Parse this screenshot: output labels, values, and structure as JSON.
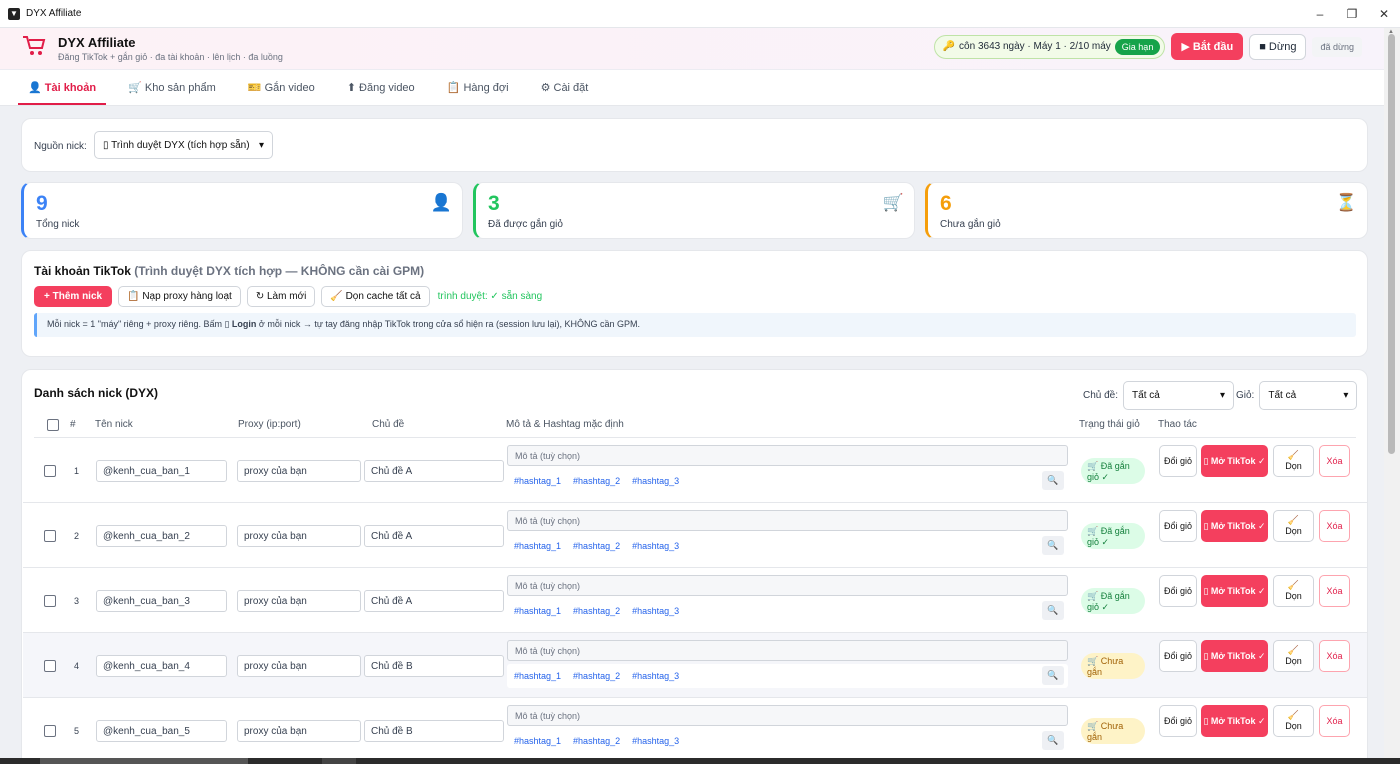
{
  "window": {
    "title": "DYX Affiliate",
    "minimize": "–",
    "maximize": "❐",
    "close": "✕"
  },
  "header": {
    "title": "DYX Affiliate",
    "subtitle": "Đăng TikTok + gắn giỏ · đa tài khoản · lên lịch · đa luồng",
    "license": "côn 3643 ngày · Máy 1 · 2/10 máy",
    "renew": "Gia hạn",
    "start": "▶ Bắt đầu",
    "stop": "■ Dừng",
    "status": "đã dừng"
  },
  "tabs": [
    "Tài khoản",
    "Kho sản phẩm",
    "Gắn video",
    "Đăng video",
    "Hàng đợi",
    "Cài đặt"
  ],
  "source": {
    "label": "Nguồn nick:",
    "value": "▯ Trình duyệt DYX (tích hợp sẵn)"
  },
  "stats": [
    {
      "value": "9",
      "label": "Tổng nick",
      "color": "#3b82f6"
    },
    {
      "value": "3",
      "label": "Đã được gắn giỏ",
      "color": "#22c55e"
    },
    {
      "value": "6",
      "label": "Chưa gắn giỏ",
      "color": "#f59e0b"
    }
  ],
  "accounts": {
    "title": "Tài khoản TikTok",
    "title_note": "(Trình duyệt DYX tích hợp — KHÔNG cần cài GPM)",
    "add": "+ Thêm nick",
    "proxy_bulk": "Nạp proxy hàng loạt",
    "refresh": "↻ Làm mới",
    "clear_cache": "Dọn cache tất cả",
    "browser_status": "trình duyệt: ✓ sẵn sàng",
    "note_pre": "Mỗi nick = 1 \"máy\" riêng + proxy riêng. Bấm ",
    "note_bold": "▯ Login",
    "note_post": " ở mỗi nick → tự tay đăng nhập TikTok trong cửa sổ hiện ra (session lưu lại), KHÔNG cần GPM."
  },
  "list": {
    "title": "Danh sách nick (DYX)",
    "topic_label": "Chủ đề:",
    "topic_value": "Tất cả",
    "cart_label": "Giỏ:",
    "cart_value": "Tất cả",
    "columns": [
      "#",
      "Tên nick",
      "Proxy (ip:port)",
      "Chủ đề",
      "Mô tả & Hashtag mặc định",
      "Trạng thái giỏ",
      "Thao tác"
    ],
    "desc_placeholder": "Mô tả (tuỳ chọn)",
    "hashtags": [
      "#hashtag_1",
      "#hashtag_2",
      "#hashtag_3"
    ],
    "btn_change": "Đổi giỏ",
    "btn_open": "▯ Mở TikTok ✓",
    "btn_clean": "Dọn",
    "btn_delete": "Xóa",
    "rows": [
      {
        "idx": "1",
        "nick": "@kenh_cua_ban_1",
        "proxy": "proxy của bạn",
        "topic": "Chủ đề A",
        "status": "Đã gắn giỏ ✓",
        "state": "ok"
      },
      {
        "idx": "2",
        "nick": "@kenh_cua_ban_2",
        "proxy": "proxy của bạn",
        "topic": "Chủ đề A",
        "status": "Đã gắn giỏ ✓",
        "state": "ok"
      },
      {
        "idx": "3",
        "nick": "@kenh_cua_ban_3",
        "proxy": "proxy của bạn",
        "topic": "Chủ đề A",
        "status": "Đã gắn giỏ ✓",
        "state": "ok"
      },
      {
        "idx": "4",
        "nick": "@kenh_cua_ban_4",
        "proxy": "proxy của bạn",
        "topic": "Chủ đề B",
        "status": "Chưa gắn",
        "state": "no"
      },
      {
        "idx": "5",
        "nick": "@kenh_cua_ban_5",
        "proxy": "proxy của bạn",
        "topic": "Chủ đề B",
        "status": "Chưa gắn",
        "state": "no"
      }
    ]
  }
}
